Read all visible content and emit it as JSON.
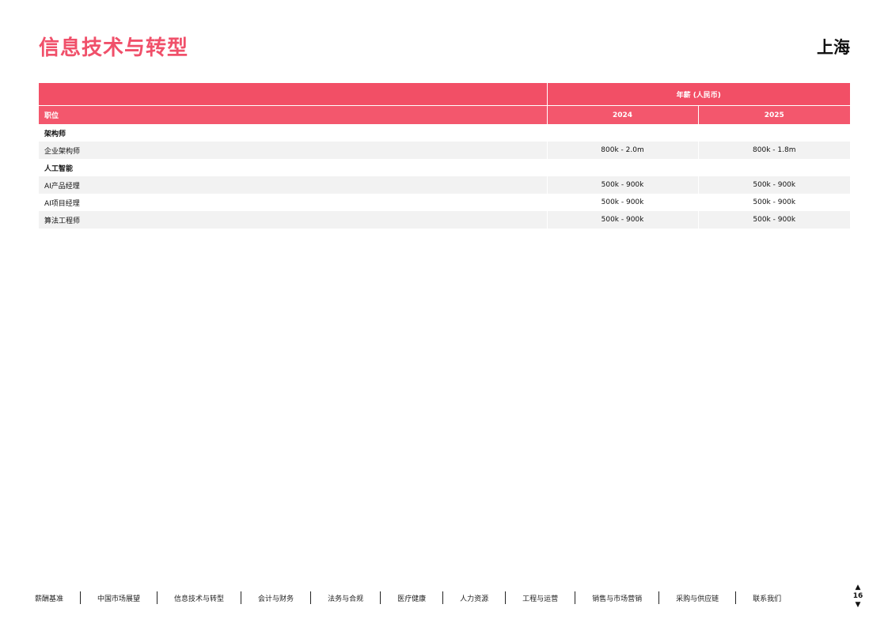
{
  "header": {
    "title": "信息技术与转型",
    "city": "上海"
  },
  "colors": {
    "accent": "#f0506a",
    "header_dark": "#f24f66",
    "header_light": "#f3576d",
    "row_shade": "#f2f2f2"
  },
  "table": {
    "group_header": "年薪 (人民币)",
    "role_header": "职位",
    "year_headers": [
      "2024",
      "2025"
    ],
    "sections": [
      {
        "category": "架构师",
        "rows": [
          {
            "role": "企业架构师",
            "y2024": "800k - 2.0m",
            "y2025": "800k - 1.8m"
          }
        ]
      },
      {
        "category": "人工智能",
        "rows": [
          {
            "role": "AI产品经理",
            "y2024": "500k - 900k",
            "y2025": "500k - 900k"
          },
          {
            "role": "AI项目经理",
            "y2024": "500k - 900k",
            "y2025": "500k - 900k"
          },
          {
            "role": "算法工程师",
            "y2024": "500k - 900k",
            "y2025": "500k - 900k"
          }
        ]
      }
    ]
  },
  "footer": {
    "nav": [
      "薪酬基准",
      "中国市场展望",
      "信息技术与转型",
      "会计与财务",
      "法务与合规",
      "医疗健康",
      "人力资源",
      "工程与运营",
      "销售与市场营销",
      "采购与供应链",
      "联系我们"
    ],
    "page_number": "16",
    "icons": {
      "up": "triangle-up-icon",
      "down": "triangle-down-icon"
    }
  }
}
